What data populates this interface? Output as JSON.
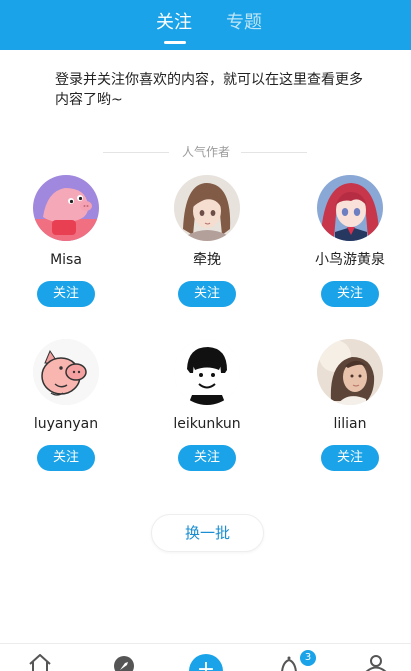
{
  "header": {
    "tabs": [
      {
        "label": "关注",
        "active": true
      },
      {
        "label": "专题",
        "active": false
      }
    ],
    "accent": "#1aa3e8"
  },
  "intro": {
    "text": "登录并关注你喜欢的内容，就可以在这里查看更多内容了哟~"
  },
  "section": {
    "title": "人气作者"
  },
  "authors": [
    {
      "name": "Misa",
      "follow_label": "关注"
    },
    {
      "name": "牵挽",
      "follow_label": "关注"
    },
    {
      "name": "小鸟游黄泉",
      "follow_label": "关注"
    },
    {
      "name": "luyanyan",
      "follow_label": "关注"
    },
    {
      "name": "leikunkun",
      "follow_label": "关注"
    },
    {
      "name": "lilian",
      "follow_label": "关注"
    }
  ],
  "refresh": {
    "label": "换一批"
  },
  "bottom_nav": {
    "add_label": "+",
    "notifications_badge": "3"
  }
}
